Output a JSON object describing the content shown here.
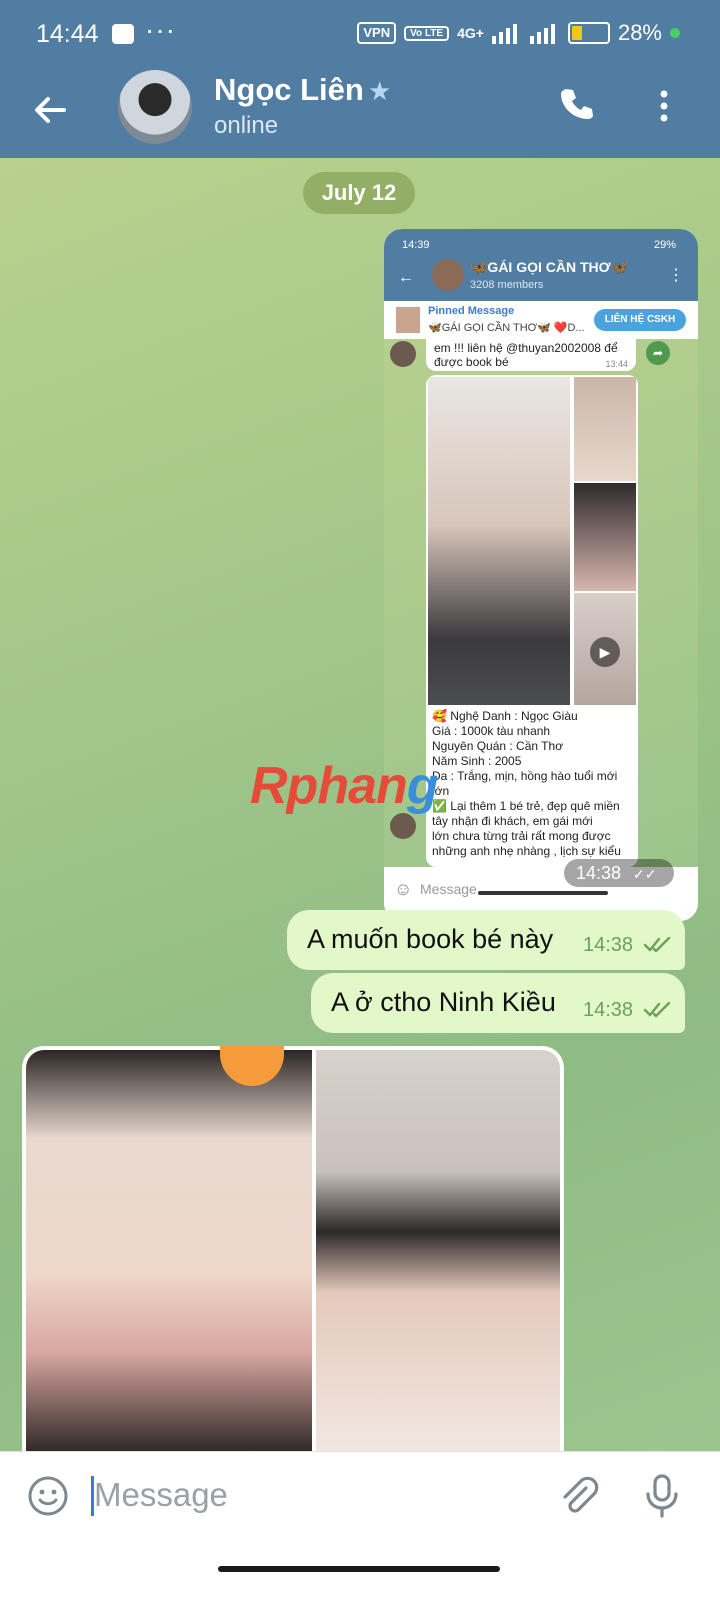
{
  "status_bar": {
    "time": "14:44",
    "more": "···",
    "vpn": "VPN",
    "volte": "Vo LTE",
    "network": "4G+",
    "battery": "28%"
  },
  "header": {
    "contact_name": "Ngọc Liên",
    "star": "★",
    "status": "online",
    "icons": [
      "back-arrow-icon",
      "phone-icon",
      "more-vertical-icon"
    ]
  },
  "chat": {
    "date_label": "July 12",
    "screenshot": {
      "time": "14:39",
      "battery": "29%",
      "group_title": "🦋GÁI GỌI CẦN THƠ🦋",
      "members": "3208 members",
      "pinned_title": "Pinned Message",
      "pinned_text": "🦋GÁI GỌI CẦN THƠ🦋 ❤️D...",
      "pinned_button": "LIÊN HỆ CSKH",
      "prev_msg_line1": "em !!! liên hệ @thuyan2002008 để",
      "prev_msg_line2": "được book bé",
      "prev_msg_time": "13:44",
      "caption_lines": [
        "🥰 Nghệ Danh : Ngọc Giàu",
        "Giá : 1000k  tàu nhanh",
        "Nguyên Quán : Cần Thơ",
        "Năm Sinh : 2005",
        "Da : Trắng, mịn, hồng hào tuổi mới",
        "lớn",
        "✅ Lại thêm 1 bé trẻ, đẹp quê miền",
        "tây nhận đi khách, em gái mới",
        "lớn chưa từng trải rất mong được",
        "những anh nhẹ nhàng , lịch sự kiểu"
      ],
      "input_placeholder": "Message",
      "bubble_time": "14:38"
    },
    "messages": [
      {
        "text": "A muốn book bé này",
        "time": "14:38",
        "status": "read"
      },
      {
        "text": "A ở ctho Ninh Kiều",
        "time": "14:38",
        "status": "read"
      }
    ],
    "watermark": {
      "part1": "Rphan",
      "part2": "g"
    }
  },
  "input_bar": {
    "placeholder": "Message",
    "icons": [
      "emoji-icon",
      "attach-icon",
      "microphone-icon"
    ]
  },
  "colors": {
    "header_bg": "#517da2",
    "bubble_out": "#e2f8c9",
    "check_green": "#6aa257",
    "accent_blue": "#3a7bd5"
  }
}
